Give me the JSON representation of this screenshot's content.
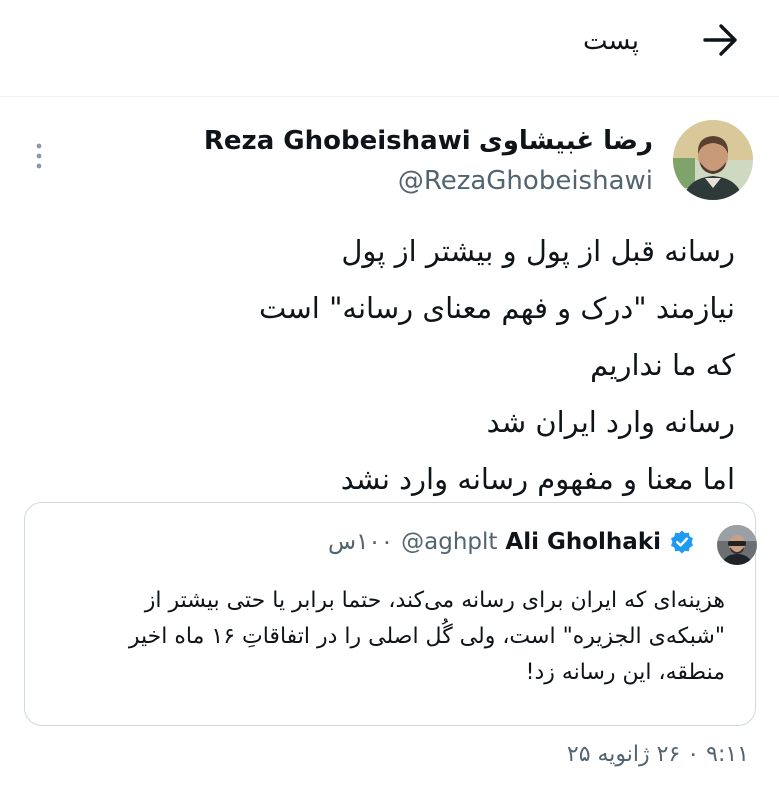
{
  "header": {
    "title": "پست"
  },
  "author": {
    "name_fa": "رضا غبیشاوی",
    "name_en": "Reza Ghobeishawi",
    "handle": "@RezaGhobeishawi"
  },
  "tweet": {
    "lines": [
      "رسانه قبل از پول و بیشتر  از پول",
      "نیازمند \"درک و فهم معنای رسانه\" است",
      "که ما نداریم",
      "رسانه وارد ایران شد",
      "اما معنا و مفهوم رسانه وارد نشد"
    ]
  },
  "quote": {
    "name": "Ali Gholhaki",
    "handle": "@aghplt",
    "time": "۱۰۰س",
    "lines": [
      "هزینه‌ای که ایران برای رسانه می‌کند، حتما برابر یا حتی بیشتر از",
      "\"شبکه‌ی الجزیره\" است، ولی گُل اصلی را در اتفاقاتِ ۱۶ ماه اخیر",
      "منطقه، این رسانه زد!"
    ]
  },
  "timestamp": "۹:۱۱ ۰ ۲۶ ژانویه ۲۵",
  "icons": {
    "back": "arrow-icon",
    "more": "vertical-dots-icon",
    "verified": "verified-badge-icon"
  },
  "colors": {
    "accent": "#1d9bf0",
    "muted": "#536471",
    "border": "#cfd9de"
  }
}
